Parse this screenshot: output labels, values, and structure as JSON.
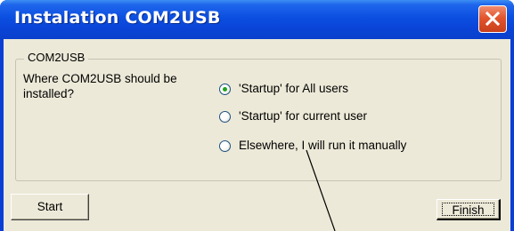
{
  "window": {
    "title": "Instalation COM2USB"
  },
  "group": {
    "title": "COM2USB",
    "question": "Where COM2USB should be installed?"
  },
  "options": [
    {
      "label": "'Startup' for All users",
      "selected": true
    },
    {
      "label": "'Startup' for current user",
      "selected": false
    },
    {
      "label": "Elsewhere, I will run it manually",
      "selected": false
    }
  ],
  "buttons": {
    "start_label": "Start",
    "finish_label": "Finish"
  },
  "icons": {
    "close": "close-icon"
  },
  "colors": {
    "titlebar": "#0a45d8",
    "client": "#ece9d8",
    "close": "#e2552e",
    "radio_dot": "#21a121"
  }
}
